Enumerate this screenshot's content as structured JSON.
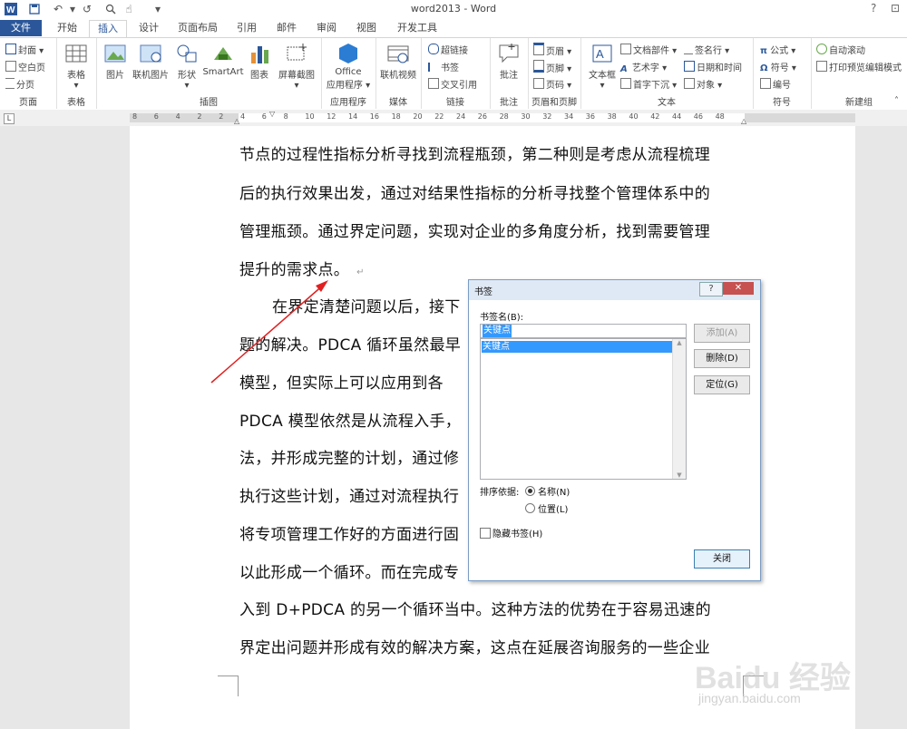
{
  "window": {
    "title": "word2013 - Word",
    "help": "?",
    "minimize": "—",
    "maximize": "☐"
  },
  "tabs": [
    {
      "label": "文件"
    },
    {
      "label": "开始"
    },
    {
      "label": "插入"
    },
    {
      "label": "设计"
    },
    {
      "label": "页面布局"
    },
    {
      "label": "引用"
    },
    {
      "label": "邮件"
    },
    {
      "label": "审阅"
    },
    {
      "label": "视图"
    },
    {
      "label": "开发工具"
    }
  ],
  "ribbon": {
    "pages": {
      "group": "页面",
      "cover": "封面",
      "blank": "空白页",
      "break": "分页"
    },
    "tables": {
      "group": "表格",
      "table": "表格"
    },
    "illustrations": {
      "group": "插图",
      "picture": "图片",
      "online_picture": "联机图片",
      "shapes": "形状",
      "smartart": "SmartArt",
      "chart": "图表",
      "screenshot": "屏幕截图"
    },
    "apps": {
      "group": "应用程序",
      "office_line1": "Office",
      "office_line2": "应用程序"
    },
    "media": {
      "group": "媒体",
      "online_video": "联机视频"
    },
    "links": {
      "group": "链接",
      "hyperlink": "超链接",
      "bookmark": "书签",
      "crossref": "交叉引用"
    },
    "comments": {
      "group": "批注",
      "comment": "批注"
    },
    "header_footer": {
      "group": "页眉和页脚",
      "header": "页眉",
      "footer": "页脚",
      "page_number": "页码"
    },
    "text": {
      "group": "文本",
      "textbox": "文本框",
      "quickparts": "文档部件",
      "wordart": "艺术字",
      "dropcap": "首字下沉",
      "signature": "签名行",
      "datetime": "日期和时间",
      "object": "对象"
    },
    "symbols": {
      "group": "符号",
      "equation": "公式",
      "symbol": "符号",
      "number": "编号"
    },
    "newgroup": {
      "group": "新建组",
      "autoscroll": "自动滚动",
      "printpreview": "打印预览编辑模式"
    }
  },
  "ruler": {
    "ticks": [
      "8",
      "6",
      "4",
      "2",
      "2",
      "4",
      "6",
      "8",
      "10",
      "12",
      "14",
      "16",
      "18",
      "20",
      "22",
      "24",
      "26",
      "28",
      "30",
      "32",
      "34",
      "36",
      "38",
      "40",
      "42",
      "44",
      "46",
      "48"
    ]
  },
  "document": {
    "lines": [
      "节点的过程性指标分析寻找到流程瓶颈，第二种则是考虑从流程梳理",
      "后的执行效果出发，通过对结果性指标的分析寻找整个管理体系中的",
      "管理瓶颈。通过界定问题，实现对企业的多角度分析，找到需要管理",
      "提升的需求点。",
      "在界定清楚问题以后，接下",
      "题的解决。PDCA 循环虽然最早",
      "模型，但实际上可以应用到各",
      "PDCA 模型依然是从流程入手，",
      "法，并形成完整的计划，通过修",
      "执行这些计划，通过对流程执行",
      "将专项管理工作好的方面进行固",
      "以此形成一个循环。而在完成专",
      "入到 D+PDCA 的另一个循环当中。这种方法的优势在于容易迅速的",
      "界定出问题并形成有效的解决方案，这点在延展咨询服务的一些企业"
    ]
  },
  "dialog": {
    "title": "书签",
    "help": "?",
    "close_x": "✕",
    "name_label": "书签名(B):",
    "name_value": "关键点",
    "list": [
      "关键点"
    ],
    "add": "添加(A)",
    "delete": "删除(D)",
    "goto": "定位(G)",
    "sort_label": "排序依据:",
    "sort_name": "名称(N)",
    "sort_location": "位置(L)",
    "hidden": "隐藏书签(H)",
    "close": "关闭"
  },
  "watermark": {
    "brand": "Baidu 经验",
    "url": "jingyan.baidu.com"
  },
  "colors": {
    "accent": "#2b579a",
    "arrow": "#e02020",
    "selection": "#3399ff"
  }
}
